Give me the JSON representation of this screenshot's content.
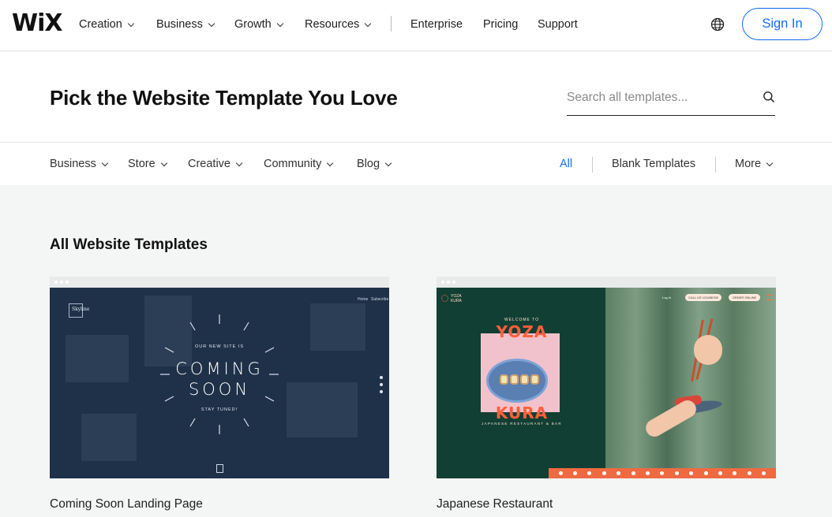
{
  "logo": "WiX",
  "topnav": {
    "items": [
      {
        "label": "Creation",
        "dropdown": true
      },
      {
        "label": "Business",
        "dropdown": true
      },
      {
        "label": "Growth",
        "dropdown": true
      },
      {
        "label": "Resources",
        "dropdown": true
      },
      {
        "label": "Enterprise",
        "dropdown": false
      },
      {
        "label": "Pricing",
        "dropdown": false
      },
      {
        "label": "Support",
        "dropdown": false
      }
    ],
    "language_icon": "globe-icon",
    "sign_in": "Sign In"
  },
  "hero": {
    "title": "Pick the Website Template You Love",
    "search_placeholder": "Search all templates...",
    "search_icon": "search-icon"
  },
  "categories": {
    "left": [
      {
        "label": "Business"
      },
      {
        "label": "Store"
      },
      {
        "label": "Creative"
      },
      {
        "label": "Community"
      },
      {
        "label": "Blog"
      }
    ],
    "right": {
      "all": "All",
      "blank": "Blank Templates",
      "more": "More"
    },
    "active": "All"
  },
  "section": {
    "title": "All Website Templates"
  },
  "templates": [
    {
      "name": "Coming Soon Landing Page",
      "preview": {
        "brand": "Skyline",
        "nav": [
          "Home",
          "Subscribe"
        ],
        "tagline": "OUR NEW SITE IS",
        "headline_1": "COMING",
        "headline_2": "SOON",
        "subline": "STAY TUNED!"
      }
    },
    {
      "name": "Japanese Restaurant",
      "preview": {
        "brand_1": "YOZA",
        "brand_2": "KURA",
        "welcome": "WELCOME TO",
        "title_1": "YOZA",
        "title_2": "KURA",
        "subtitle": "JAPANESE RESTAURANT & BAR",
        "login": "Log In",
        "call": "CALL US 123456789",
        "order": "ORDER ONLINE"
      }
    }
  ],
  "colors": {
    "accent": "#116dff",
    "page_bg": "#f4f5f5",
    "restaurant_orange": "#ef6a41"
  }
}
